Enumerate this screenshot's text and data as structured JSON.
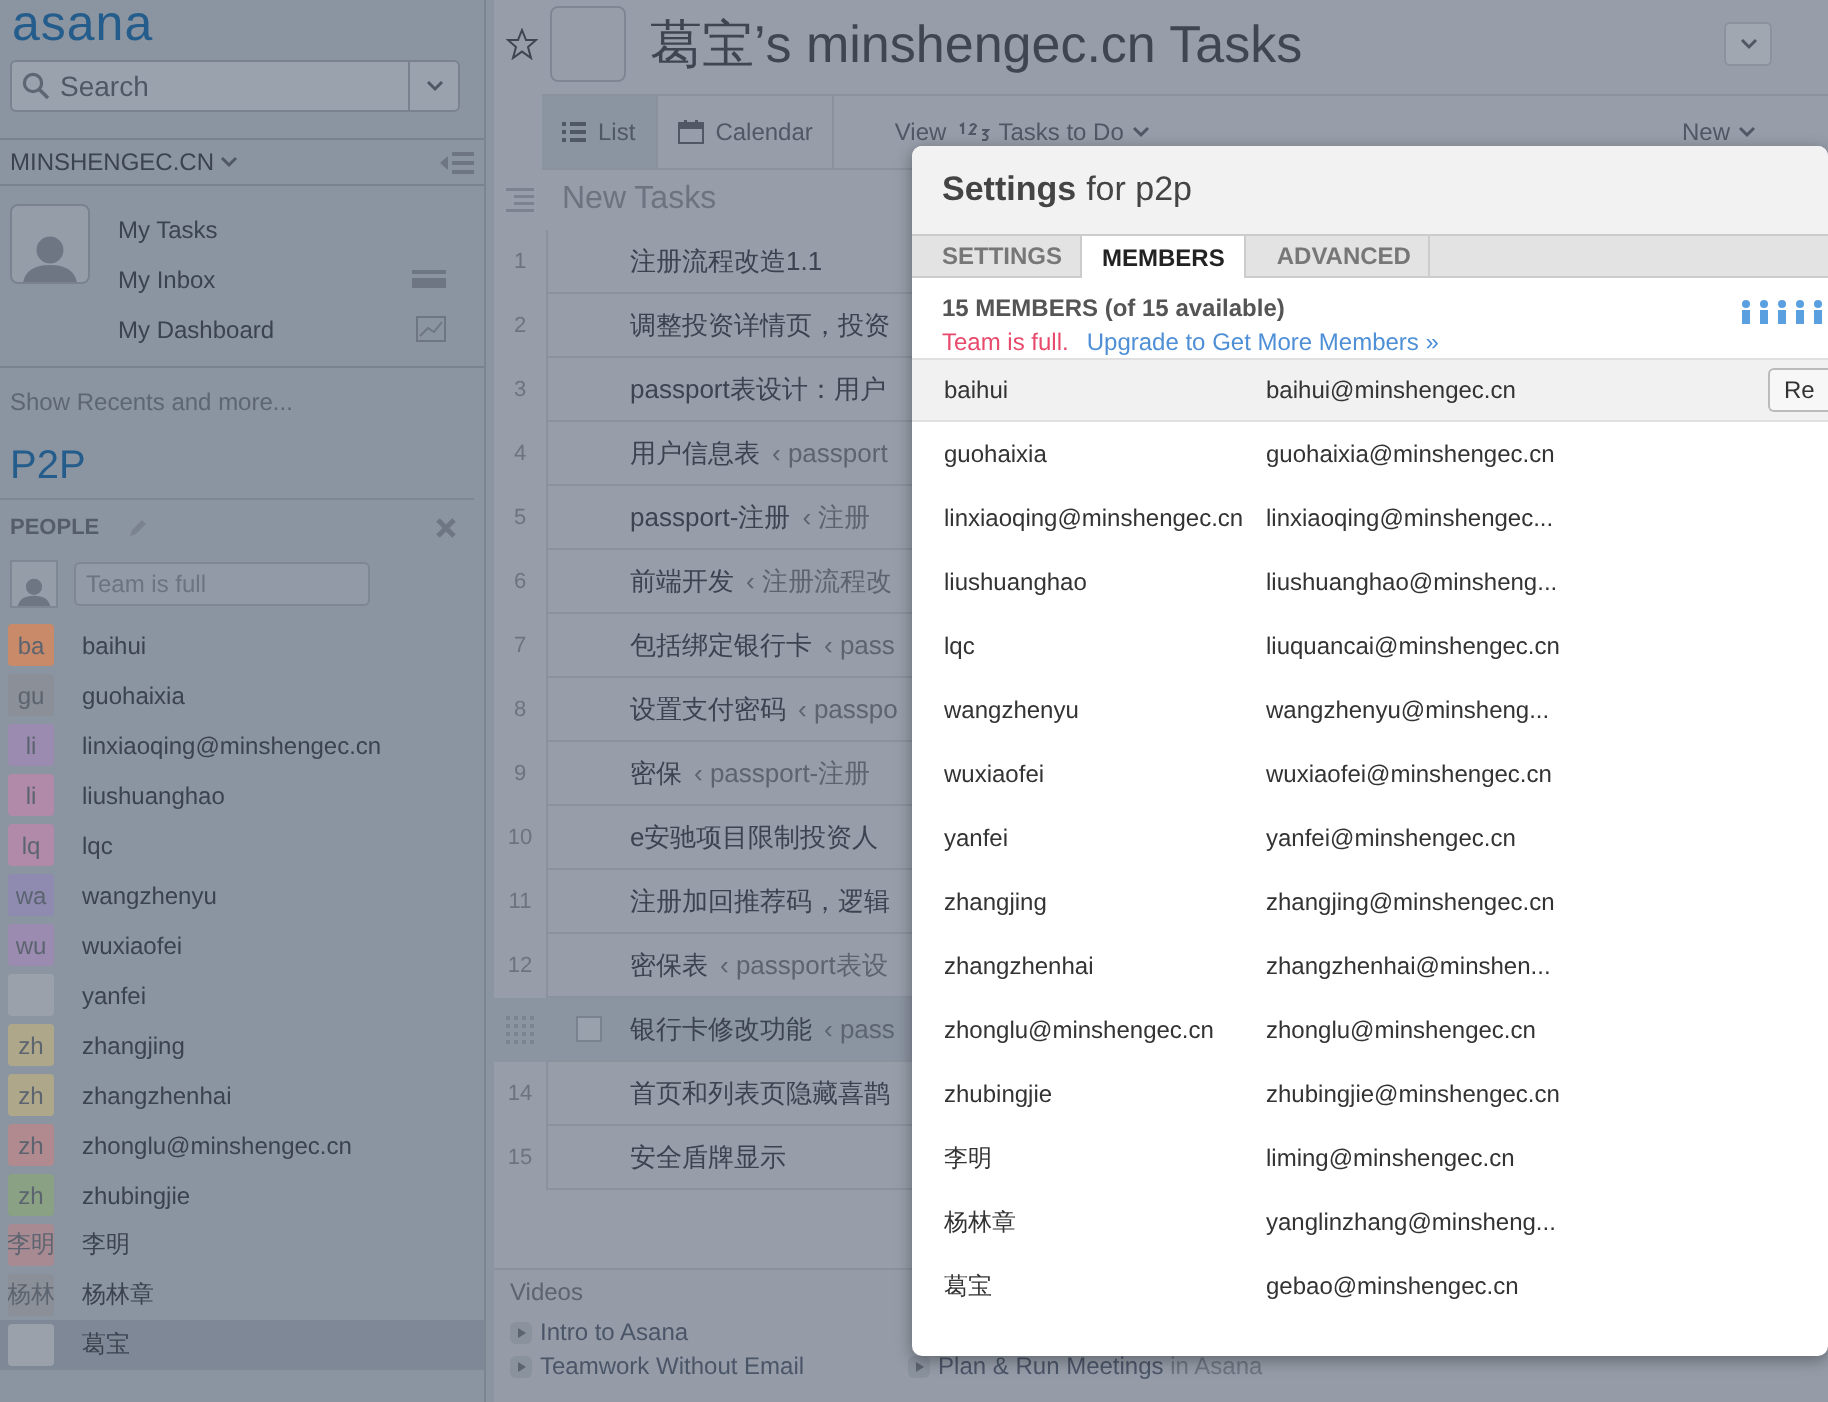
{
  "sidebar": {
    "logo": "asana",
    "search": {
      "placeholder": "Search"
    },
    "workspace": "MINSHENGEC.CN",
    "nav": [
      {
        "label": "My Tasks"
      },
      {
        "label": "My Inbox"
      },
      {
        "label": "My Dashboard"
      }
    ],
    "show_recents": "Show Recents and more...",
    "project": "P2P",
    "people_header": "PEOPLE",
    "invite": {
      "placeholder": "Team is full"
    },
    "people": [
      {
        "initials": "ba",
        "name": "baihui",
        "color": "#c98a6a",
        "selected": false
      },
      {
        "initials": "gu",
        "name": "guohaixia",
        "color": "#8a8f98",
        "selected": false
      },
      {
        "initials": "li",
        "name": "linxiaoqing@minshengec.cn",
        "color": "#9c8bb0",
        "selected": false
      },
      {
        "initials": "li",
        "name": "liushuanghao",
        "color": "#b08aa8",
        "selected": false
      },
      {
        "initials": "lq",
        "name": "lqc",
        "color": "#b08aa8",
        "selected": false
      },
      {
        "initials": "wa",
        "name": "wangzhenyu",
        "color": "#8f8bb0",
        "selected": false
      },
      {
        "initials": "wu",
        "name": "wuxiaofei",
        "color": "#9c8bb0",
        "selected": false
      },
      {
        "name": "yanfei",
        "color": "#9aa1ab",
        "selected": false
      },
      {
        "initials": "zh",
        "name": "zhangjing",
        "color": "#aea78a",
        "selected": false
      },
      {
        "initials": "zh",
        "name": "zhangzhenhai",
        "color": "#aea78a",
        "selected": false
      },
      {
        "initials": "zh",
        "name": "zhonglu@minshengec.cn",
        "color": "#b08a8f",
        "selected": false
      },
      {
        "initials": "zh",
        "name": "zhubingjie",
        "color": "#8aa184",
        "selected": false
      },
      {
        "initials": "李明",
        "name": "李明",
        "color": "#a88a92",
        "selected": false
      },
      {
        "initials": "杨林",
        "name": "杨林章",
        "color": "#8a8f98",
        "selected": false
      },
      {
        "name": "葛宝",
        "color": "#9aa1ab",
        "selected": true
      }
    ]
  },
  "header": {
    "title": "葛宝’s minshengec.cn Tasks",
    "starred": false
  },
  "toolbar": {
    "views": [
      {
        "label": "List",
        "selected": true
      },
      {
        "label": "Calendar",
        "selected": false
      }
    ],
    "view_label": "View",
    "filter": "Tasks to Do",
    "new": "New"
  },
  "list": {
    "section": "New Tasks",
    "tasks": [
      {
        "number": "1",
        "name": "注册流程改造1.1",
        "selected": false
      },
      {
        "number": "2",
        "name": "调整投资详情页，投资",
        "selected": false
      },
      {
        "number": "3",
        "name": "passport表设计：用户",
        "selected": false
      },
      {
        "number": "4",
        "name": "用户信息表",
        "parent": "‹ passport",
        "selected": false
      },
      {
        "number": "5",
        "name": "passport-注册",
        "parent": "‹ 注册",
        "selected": false
      },
      {
        "number": "6",
        "name": "前端开发",
        "parent": "‹ 注册流程改",
        "selected": false
      },
      {
        "number": "7",
        "name": "包括绑定银行卡",
        "parent": "‹ pass",
        "selected": false
      },
      {
        "number": "8",
        "name": "设置支付密码",
        "parent": "‹ passpo",
        "selected": false
      },
      {
        "number": "9",
        "name": "密保",
        "parent": "‹ passport-注册",
        "selected": false
      },
      {
        "number": "10",
        "name": "e安驰项目限制投资人",
        "selected": false
      },
      {
        "number": "11",
        "name": "注册加回推荐码，逻辑",
        "selected": false
      },
      {
        "number": "12",
        "name": "密保表",
        "parent": "‹ passport表设",
        "selected": false
      },
      {
        "name": "银行卡修改功能",
        "parent": "‹ pass",
        "selected": true
      },
      {
        "number": "14",
        "name": "首页和列表页隐藏喜鹊",
        "selected": false
      },
      {
        "number": "15",
        "name": "安全盾牌显示",
        "selected": false
      }
    ]
  },
  "videos": {
    "title": "Videos",
    "items": [
      {
        "label": "Intro to Asana"
      },
      {
        "label": "Teamwork Without Email"
      },
      {
        "label": "Plan & Run Meetings",
        "suffix": "in Asana"
      }
    ]
  },
  "dialog": {
    "title": "Settings",
    "subtitle": "for p2p",
    "tabs": [
      {
        "label": "SETTINGS",
        "selected": false
      },
      {
        "label": "MEMBERS",
        "selected": true
      },
      {
        "label": "ADVANCED",
        "selected": false
      }
    ],
    "count": "15 MEMBERS (of 15 available)",
    "notice": "Team is full.",
    "upgrade_link": "Upgrade to Get More Members »",
    "remove_button": "Re",
    "members": [
      {
        "name": "baihui",
        "email": "baihui@minshengec.cn",
        "selected": true
      },
      {
        "name": "guohaixia",
        "email": "guohaixia@minshengec.cn",
        "selected": false
      },
      {
        "name": "linxiaoqing@minshengec.cn",
        "email": "linxiaoqing@minshengec...",
        "selected": false
      },
      {
        "name": "liushuanghao",
        "email": "liushuanghao@minsheng...",
        "selected": false
      },
      {
        "name": "lqc",
        "email": "liuquancai@minshengec.cn",
        "selected": false
      },
      {
        "name": "wangzhenyu",
        "email": "wangzhenyu@minsheng...",
        "selected": false
      },
      {
        "name": "wuxiaofei",
        "email": "wuxiaofei@minshengec.cn",
        "selected": false
      },
      {
        "name": "yanfei",
        "email": "yanfei@minshengec.cn",
        "selected": false
      },
      {
        "name": "zhangjing",
        "email": "zhangjing@minshengec.cn",
        "selected": false
      },
      {
        "name": "zhangzhenhai",
        "email": "zhangzhenhai@minshen...",
        "selected": false
      },
      {
        "name": "zhonglu@minshengec.cn",
        "email": "zhonglu@minshengec.cn",
        "selected": false
      },
      {
        "name": "zhubingjie",
        "email": "zhubingjie@minshengec.cn",
        "selected": false
      },
      {
        "name": "李明",
        "email": "liming@minshengec.cn",
        "selected": false
      },
      {
        "name": "杨林章",
        "email": "yanglinzhang@minsheng...",
        "selected": false
      },
      {
        "name": "葛宝",
        "email": "gebao@minshengec.cn",
        "selected": false
      }
    ]
  }
}
